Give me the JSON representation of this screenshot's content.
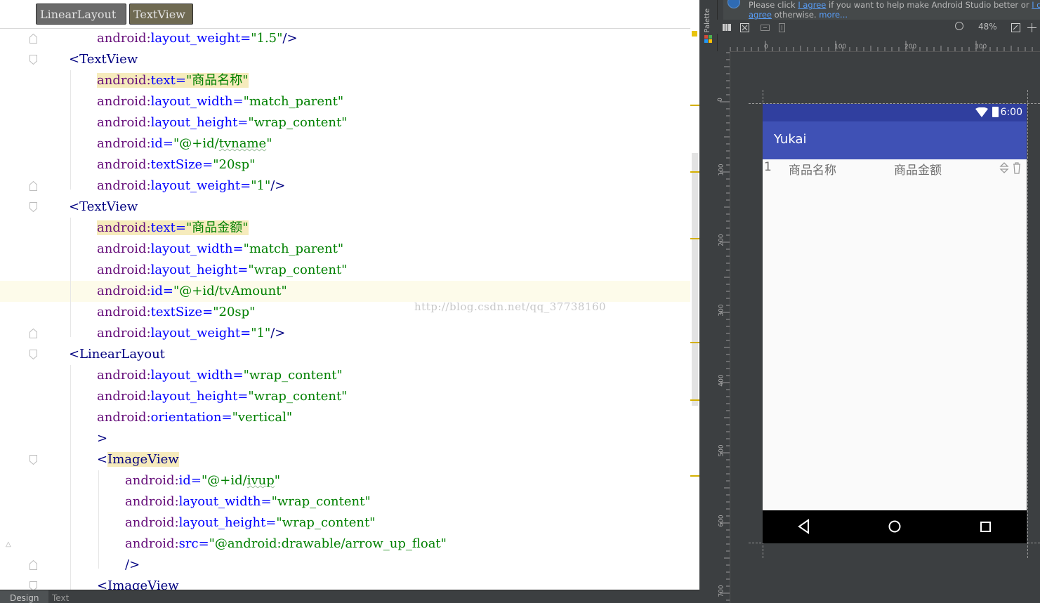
{
  "breadcrumb": [
    "LinearLayout",
    "TextView"
  ],
  "code_lines": [
    "android:layout_weight=\"1.5\"/>",
    "<TextView",
    "android:text=\"商品名称\"",
    "android:layout_width=\"match_parent\"",
    "android:layout_height=\"wrap_content\"",
    "android:id=\"@+id/tvname\"",
    "android:textSize=\"20sp\"",
    "android:layout_weight=\"1\"/>",
    "<TextView",
    "android:text=\"商品金额\"",
    "android:layout_width=\"match_parent\"",
    "android:layout_height=\"wrap_content\"",
    "android:id=\"@+id/tvAmount\"",
    "android:textSize=\"20sp\"",
    "android:layout_weight=\"1\"/>",
    "<LinearLayout",
    "android:layout_width=\"wrap_content\"",
    "android:layout_height=\"wrap_content\"",
    "android:orientation=\"vertical\"",
    ">",
    "<ImageView",
    "android:id=\"@+id/ivup\"",
    "android:layout_width=\"wrap_content\"",
    "android:layout_height=\"wrap_content\"",
    "android:src=\"@android:drawable/arrow_up_float\"",
    "/>",
    "<ImageView"
  ],
  "watermark": "http://blog.csdn.net/qq_37738160",
  "bottom_tabs": [
    "Design",
    "Text"
  ],
  "palette_label": "Palette",
  "notice": {
    "prefix": "Please click ",
    "agree_link": "I agree",
    "middle": " if you want to help make Android Studio better or ",
    "dont_link": "I don't",
    "line2_link": "agree",
    "line2_rest": " otherwise. ",
    "more_link": "more..."
  },
  "zoom": "48%",
  "ruler_h": [
    "0",
    "100",
    "200",
    "300"
  ],
  "ruler_v": [
    "0",
    "100",
    "200",
    "300",
    "400",
    "500",
    "600",
    "700"
  ],
  "device": {
    "status_time": "6:00",
    "app_title": "Yukai",
    "row_number": "1",
    "row_name": "商品名称",
    "row_amount": "商品金额"
  },
  "colors": {
    "status_bar": "#303f9f",
    "app_bar": "#3f51b5",
    "ide_dark": "#3c3f41",
    "tag": "#000080",
    "namespace": "#660e7a",
    "attribute": "#0000ff",
    "value": "#008000"
  }
}
